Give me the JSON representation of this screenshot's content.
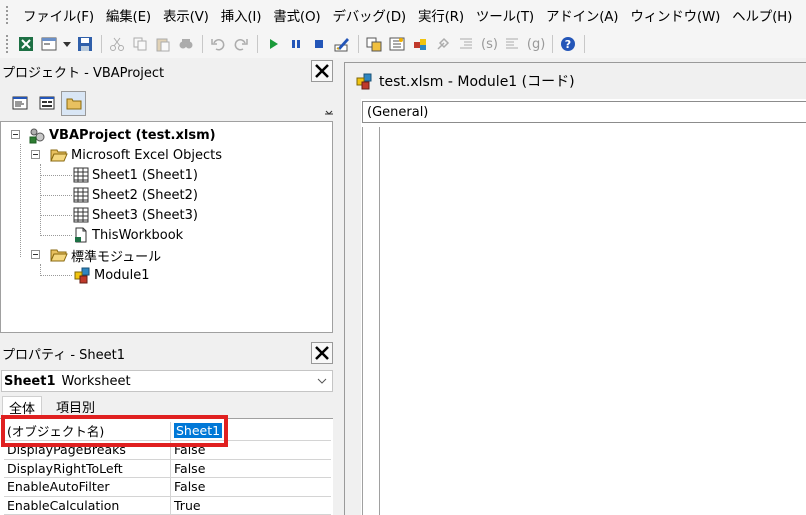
{
  "menu": [
    "ファイル(F)",
    "編集(E)",
    "表示(V)",
    "挿入(I)",
    "書式(O)",
    "デバッグ(D)",
    "実行(R)",
    "ツール(T)",
    "アドイン(A)",
    "ウィンドウ(W)",
    "ヘルプ(H)"
  ],
  "toolbar": {
    "icons": [
      "excel-icon",
      "insert-userform-icon",
      "save-icon",
      "cut-icon",
      "copy-icon",
      "paste-icon",
      "find-icon",
      "undo-icon",
      "redo-icon",
      "run-icon",
      "break-icon",
      "reset-icon",
      "design-mode-icon",
      "project-explorer-icon",
      "properties-icon",
      "object-browser-icon",
      "toolbox-icon",
      "help-icon"
    ],
    "comment_label": "(s)",
    "uncomment_label": "(g)"
  },
  "project": {
    "title": "プロジェクト - VBAProject",
    "tree": {
      "root": "VBAProject (test.xlsm)",
      "folder1": "Microsoft Excel Objects",
      "sheet1": "Sheet1 (Sheet1)",
      "sheet2": "Sheet2 (Sheet2)",
      "sheet3": "Sheet3 (Sheet3)",
      "workbook": "ThisWorkbook",
      "folder2": "標準モジュール",
      "module": "Module1"
    }
  },
  "properties": {
    "title": "プロパティ - Sheet1",
    "object_name": "Sheet1",
    "object_type": "Worksheet",
    "tabs": [
      "全体",
      "項目別"
    ],
    "rows": [
      {
        "name": "(オブジェクト名)",
        "value": "Sheet1"
      },
      {
        "name": "DisplayPageBreaks",
        "value": "False"
      },
      {
        "name": "DisplayRightToLeft",
        "value": "False"
      },
      {
        "name": "EnableAutoFilter",
        "value": "False"
      },
      {
        "name": "EnableCalculation",
        "value": "True"
      }
    ]
  },
  "code": {
    "title": "test.xlsm - Module1 (コード)",
    "object_dropdown": "(General)"
  },
  "colors": {
    "highlight": "#e02020",
    "selection": "#0078d7"
  }
}
